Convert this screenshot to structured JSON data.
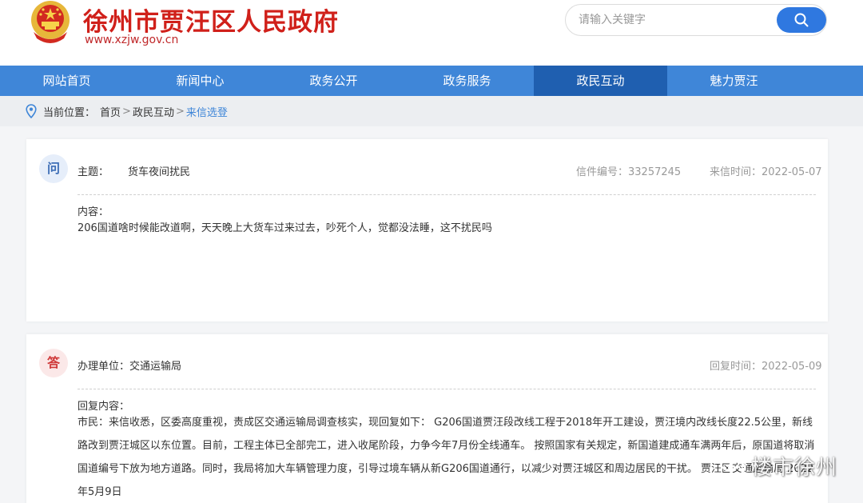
{
  "header": {
    "site_title": "徐州市贾汪区人民政府",
    "site_url": "www.xzjw.gov.cn",
    "search_placeholder": "请输入关键字",
    "accent_red": "#d0201a",
    "accent_blue": "#3f86d8"
  },
  "nav": {
    "items": [
      {
        "label": "网站首页"
      },
      {
        "label": "新闻中心"
      },
      {
        "label": "政务公开"
      },
      {
        "label": "政务服务"
      },
      {
        "label": "政民互动",
        "active": true
      },
      {
        "label": "魅力贾汪"
      }
    ]
  },
  "breadcrumb": {
    "prefix": "当前位置：",
    "items": [
      "首页",
      "政民互动",
      "来信选登"
    ],
    "separator": ">"
  },
  "question": {
    "badge": "问",
    "subject_label": "主题：",
    "subject": "货车夜间扰民",
    "letter_no": "信件编号：33257245",
    "sent_time": "来信时间：2022-05-07",
    "content_label": "内容：",
    "content": "206国道啥时候能改道啊，天天晚上大货车过来过去，吵死个人，觉都没法睡，这不扰民吗"
  },
  "answer": {
    "badge": "答",
    "unit_label": "办理单位：交通运输局",
    "reply_time": "回复时间：2022-05-09",
    "content_label": "回复内容：",
    "content": "市民：来信收悉，区委高度重视，责成区交通运输局调查核实，现回复如下： G206国道贾汪段改线工程于2018年开工建设，贾汪境内改线长度22.5公里，新线路改到贾汪城区以东位置。目前，工程主体已全部完工，进入收尾阶段，力争今年7月份全线通车。 按照国家有关规定，新国道建成通车满两年后，原国道将取消国道编号下放为地方道路。同时，我局将加大车辆管理力度，引导过境车辆从新G206国道通行，以减少对贾汪城区和周边居民的干扰。 贾汪区交通运输局 2022年5月9日"
  },
  "watermark": {
    "text": "楼市徐州",
    "icon": "wechat-icon"
  }
}
